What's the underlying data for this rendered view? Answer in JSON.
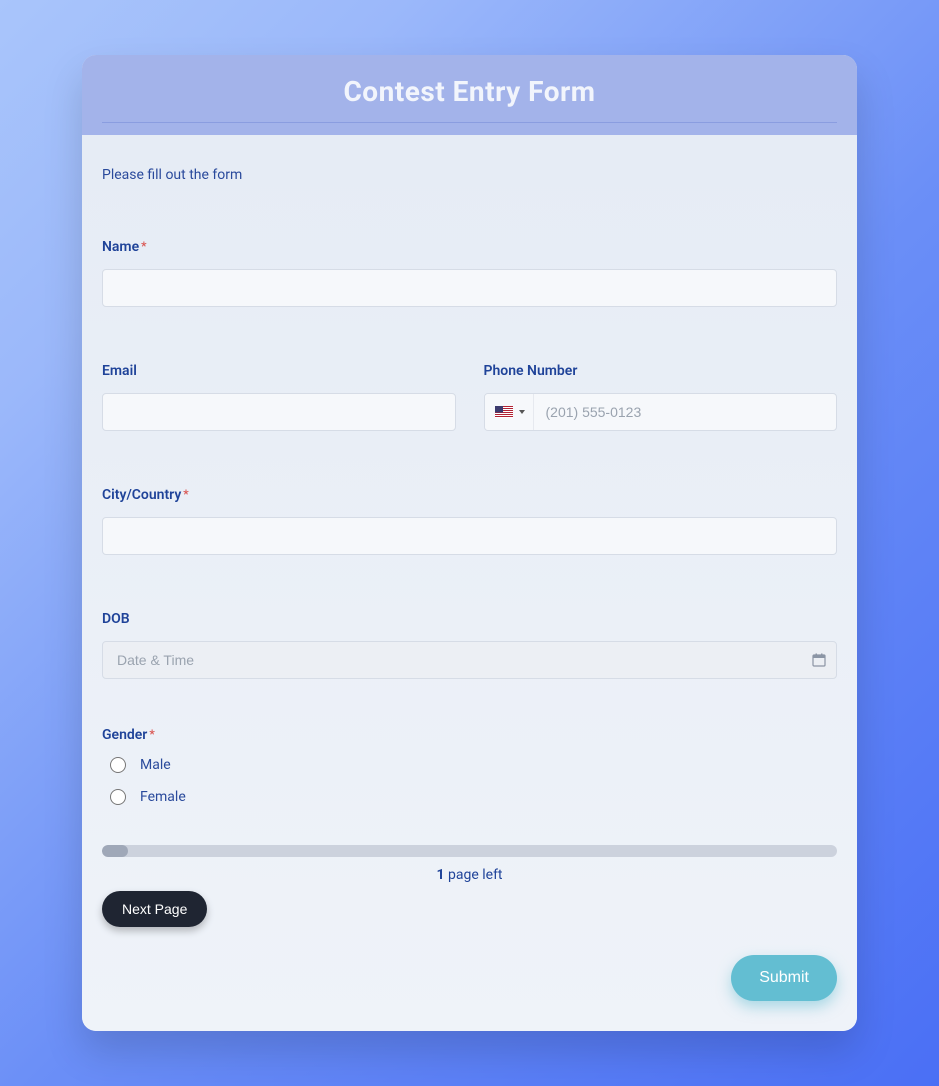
{
  "header": {
    "title": "Contest Entry Form"
  },
  "intro": "Please fill out the form",
  "fields": {
    "name": {
      "label": "Name",
      "required": true,
      "value": ""
    },
    "email": {
      "label": "Email",
      "value": ""
    },
    "phone": {
      "label": "Phone Number",
      "placeholder": "(201) 555-0123",
      "value": "",
      "country": "US"
    },
    "cityCountry": {
      "label": "City/Country",
      "required": true,
      "value": ""
    },
    "dob": {
      "label": "DOB",
      "placeholder": "Date & Time",
      "value": ""
    },
    "gender": {
      "label": "Gender",
      "required": true,
      "options": [
        "Male",
        "Female"
      ],
      "selected": null
    }
  },
  "progress": {
    "pagesLeft": 1,
    "suffix": " page left",
    "percent": 3.5
  },
  "buttons": {
    "next": "Next Page",
    "submit": "Submit"
  },
  "requiredMarker": "*"
}
